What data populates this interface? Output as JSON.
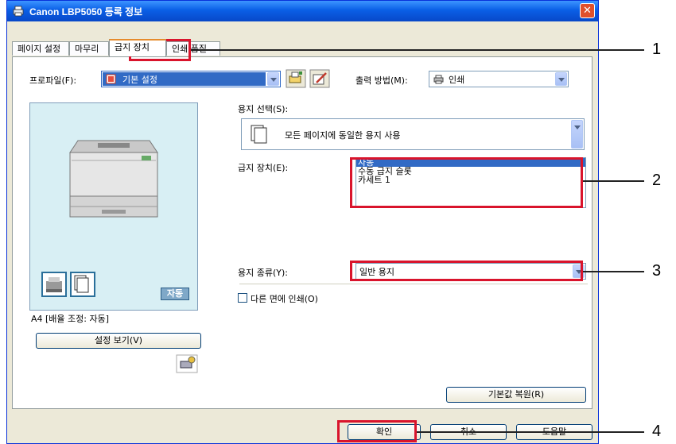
{
  "window": {
    "title": "Canon LBP5050 등록 정보",
    "close": "✕"
  },
  "tabs": [
    "페이지 설정",
    "마무리",
    "급지 장치",
    "인쇄 품질"
  ],
  "profile": {
    "label": "프로파일(F):",
    "value": "기본 설정"
  },
  "output": {
    "label": "출력 방법(M):",
    "value": "인쇄"
  },
  "paper_select": {
    "label": "용지 선택(S):",
    "value": "모든 페이지에 동일한 용지 사용"
  },
  "paper_source": {
    "label": "급지 장치(E):",
    "items": [
      "자동",
      "수동 급지 슬롯",
      "카세트 1"
    ],
    "selected": "자동"
  },
  "paper_type": {
    "label": "용지 종류(Y):",
    "value": "일반 용지"
  },
  "duplex": {
    "label": "다른 면에 인쇄(O)"
  },
  "preview": {
    "badge": "자동",
    "caption": "A4 [배율 조정: 자동]"
  },
  "buttons": {
    "view_settings": "설정 보기(V)",
    "restore_defaults": "기본값 복원(R)",
    "ok": "확인",
    "cancel": "취소",
    "help": "도움말"
  },
  "callouts": [
    "1",
    "2",
    "3",
    "4"
  ]
}
